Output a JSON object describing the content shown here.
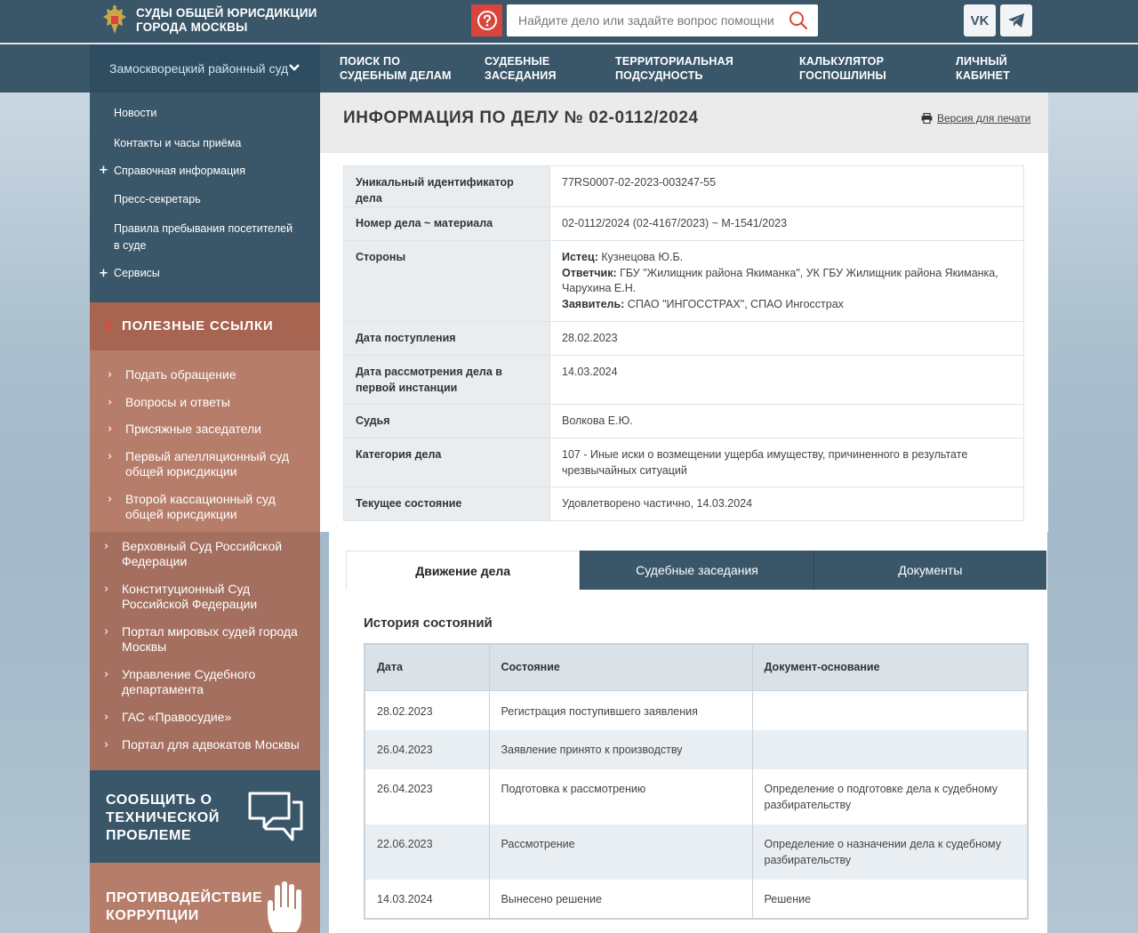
{
  "header": {
    "site_title": "СУДЫ ОБЩЕЙ ЮРИСДИКЦИИ ГОРОДА МОСКВЫ",
    "search_placeholder": "Найдите дело или задайте вопрос помощнику",
    "social": {
      "vk_label": "VK"
    }
  },
  "nav": {
    "court_select": "Замоскворецкий районный суд",
    "items": [
      {
        "label": "ПОИСК ПО СУДЕБНЫМ ДЕЛАМ"
      },
      {
        "label": "СУДЕБНЫЕ ЗАСЕДАНИЯ"
      },
      {
        "label": "ТЕРРИТОРИАЛЬНАЯ ПОДСУДНОСТЬ"
      },
      {
        "label": "КАЛЬКУЛЯТОР ГОСПОШЛИНЫ"
      },
      {
        "label": "ЛИЧНЫЙ КАБИНЕТ"
      }
    ]
  },
  "sidebar": {
    "menu": [
      {
        "label": "Новости",
        "plus": ""
      },
      {
        "label": "Контакты и часы приёма",
        "plus": ""
      },
      {
        "label": "Справочная информация",
        "plus": "+"
      },
      {
        "label": "Пресс-секретарь",
        "plus": ""
      },
      {
        "label": "Правила пребывания посетителей в суде",
        "plus": ""
      },
      {
        "label": "Сервисы",
        "plus": "+"
      }
    ],
    "useful_title": "ПОЛЕЗНЫЕ ССЫЛКИ",
    "useful_links": [
      {
        "label": "Подать обращение"
      },
      {
        "label": "Вопросы и ответы"
      },
      {
        "label": "Присяжные заседатели"
      },
      {
        "label": "Первый апелляционный суд общей юрисдикции"
      },
      {
        "label": "Второй кассационный суд общей юрисдикции"
      },
      {
        "label": "Верховный Суд Российской Федерации"
      },
      {
        "label": "Конституционный Суд Российской Федерации"
      },
      {
        "label": "Портал мировых судей города Москвы"
      },
      {
        "label": "Управление Судебного департамента"
      },
      {
        "label": "ГАС «Правосудие»"
      },
      {
        "label": "Портал для адвокатов Москвы"
      }
    ],
    "report_label": "СООБЩИТЬ О ТЕХНИЧЕСКОЙ ПРОБЛЕМЕ",
    "anticor_label": "ПРОТИВОДЕЙСТВИЕ КОРРУПЦИИ"
  },
  "case": {
    "title": "ИНФОРМАЦИЯ ПО ДЕЛУ № 02-0112/2024",
    "print_label": "Версия для печати",
    "rows": [
      {
        "key": "Уникальный идентификатор дела",
        "value": "77RS0007-02-2023-003247-55"
      },
      {
        "key": "Номер дела ~ материала",
        "value": "02-0112/2024 (02-4167/2023) ~ М-1541/2023"
      },
      {
        "key": "Стороны",
        "value": ""
      },
      {
        "key": "Дата поступления",
        "value": "28.02.2023"
      },
      {
        "key": "Дата рассмотрения дела в первой инстанции",
        "value": "14.03.2024"
      },
      {
        "key": "Судья",
        "value": "Волкова Е.Ю."
      },
      {
        "key": "Категория дела",
        "value": "107 - Иные иски о возмещении ущерба имуществу, причиненного в результате чрезвычайных ситуаций"
      },
      {
        "key": "Текущее состояние",
        "value": "Удовлетворено частично, 14.03.2024"
      }
    ],
    "parties": [
      {
        "role": "Истец:",
        "names": "Кузнецова Ю.Б."
      },
      {
        "role": "Ответчик:",
        "names": "ГБУ \"Жилищник района Якиманка\", УК ГБУ Жилищник района Якиманка, Чарухина Е.Н."
      },
      {
        "role": "Заявитель:",
        "names": "СПАО \"ИНГОССТРАХ\", СПАО Ингосстрах"
      }
    ]
  },
  "tabs": [
    {
      "label": "Движение дела",
      "active": true
    },
    {
      "label": "Судебные заседания",
      "active": false
    },
    {
      "label": "Документы",
      "active": false
    }
  ],
  "history": {
    "title": "История состояний",
    "columns": [
      "Дата",
      "Состояние",
      "Документ-основание"
    ],
    "rows": [
      {
        "date": "28.02.2023",
        "state": "Регистрация поступившего заявления",
        "doc": ""
      },
      {
        "date": "26.04.2023",
        "state": "Заявление принято к производству",
        "doc": ""
      },
      {
        "date": "26.04.2023",
        "state": "Подготовка к рассмотрению",
        "doc": "Определение о подготовке дела к судебному разбирательству"
      },
      {
        "date": "22.06.2023",
        "state": "Рассмотрение",
        "doc": "Определение о назначении дела к судебному разбирательству"
      },
      {
        "date": "14.03.2024",
        "state": "Вынесено решение",
        "doc": "Решение"
      }
    ]
  },
  "colors": {
    "primary": "#3a5769",
    "accent_red": "#d9453d",
    "useful_bg": "#b67d6a"
  }
}
